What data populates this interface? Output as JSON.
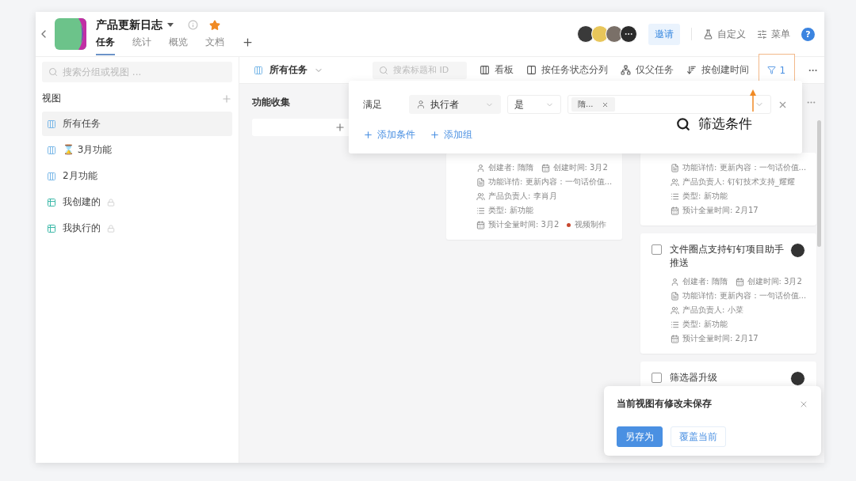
{
  "header": {
    "title": "产品更新日志",
    "tabs": [
      {
        "label": "任务",
        "selected": true
      },
      {
        "label": "统计",
        "selected": false
      },
      {
        "label": "概览",
        "selected": false
      },
      {
        "label": "文档",
        "selected": false
      }
    ],
    "invite": "邀请",
    "actions": [
      {
        "kind": "customize",
        "label": "自定义"
      },
      {
        "kind": "menu",
        "label": "菜单"
      }
    ],
    "help": "?"
  },
  "sidebar": {
    "search_placeholder": "搜索分组或视图 ...",
    "section": "视图",
    "items": [
      {
        "kind": "board",
        "label": "所有任务",
        "selected": true,
        "locked": false
      },
      {
        "kind": "board",
        "label": "⌛ 3月功能",
        "selected": false,
        "locked": false
      },
      {
        "kind": "board",
        "label": "2月功能",
        "selected": false,
        "locked": false
      },
      {
        "kind": "table",
        "label": "我创建的",
        "selected": false,
        "locked": true
      },
      {
        "kind": "table",
        "label": "我执行的",
        "selected": false,
        "locked": true
      }
    ]
  },
  "toolbar": {
    "view": "所有任务",
    "search_placeholder": "搜索标题和 ID",
    "buttons": [
      {
        "kind": "board",
        "label": "看板"
      },
      {
        "kind": "columns",
        "label": "按任务状态分列"
      },
      {
        "kind": "tree",
        "label": "仅父任务"
      },
      {
        "kind": "sort",
        "label": "按创建时间"
      }
    ],
    "filter": {
      "count": "1",
      "active": true
    }
  },
  "filter_popover": {
    "match": "满足",
    "field": "执行者",
    "operator": "是",
    "value": "隋...",
    "add_condition": "添加条件",
    "add_group": "添加组"
  },
  "annotation": {
    "text": "筛选条件"
  },
  "columns": [
    {
      "title": "功能收集"
    },
    {
      "cards": [
        {
          "meta": [
            [
              {
                "kind": "user",
                "text": "创建者: 隋隋"
              },
              {
                "kind": "calendar",
                "text": "创建时间: 3月2"
              }
            ],
            [
              {
                "kind": "doc",
                "text": "功能详情: 更新内容：一句话价值..."
              }
            ],
            [
              {
                "kind": "people",
                "text": "产品负责人: 李肖月"
              }
            ],
            [
              {
                "kind": "list",
                "text": "类型: 新功能"
              }
            ],
            [
              {
                "kind": "calendar",
                "text": "预计全量时间: 3月2"
              }
            ]
          ],
          "tag": {
            "text": "视频制作",
            "color": "#c8472f"
          }
        }
      ]
    },
    {
      "cards": [
        {
          "meta": [
            [
              {
                "kind": "doc",
                "text": "功能详情: 更新内容：一句话价值..."
              }
            ],
            [
              {
                "kind": "people",
                "text": "产品负责人: 钉钉技术支持_耀耀"
              }
            ],
            [
              {
                "kind": "list",
                "text": "类型: 新功能"
              }
            ],
            [
              {
                "kind": "calendar",
                "text": "预计全量时间: 2月17"
              }
            ]
          ]
        },
        {
          "title": "文件圈点支持钉钉项目助手推送",
          "checked": false,
          "meta": [
            [
              {
                "kind": "user",
                "text": "创建者: 隋隋"
              },
              {
                "kind": "calendar",
                "text": "创建时间: 3月2"
              }
            ],
            [
              {
                "kind": "doc",
                "text": "功能详情: 更新内容：一句话价值..."
              }
            ],
            [
              {
                "kind": "people",
                "text": "产品负责人: 小菜"
              }
            ],
            [
              {
                "kind": "list",
                "text": "类型: 新功能"
              }
            ],
            [
              {
                "kind": "calendar",
                "text": "预计全量时间: 2月17"
              }
            ]
          ]
        },
        {
          "title": "筛选器升级",
          "checked": false
        }
      ]
    }
  ],
  "toast": {
    "message": "当前视图有修改未保存",
    "buttons": [
      {
        "kind": "primary",
        "label": "另存为"
      },
      {
        "kind": "secondary",
        "label": "覆盖当前"
      }
    ]
  }
}
